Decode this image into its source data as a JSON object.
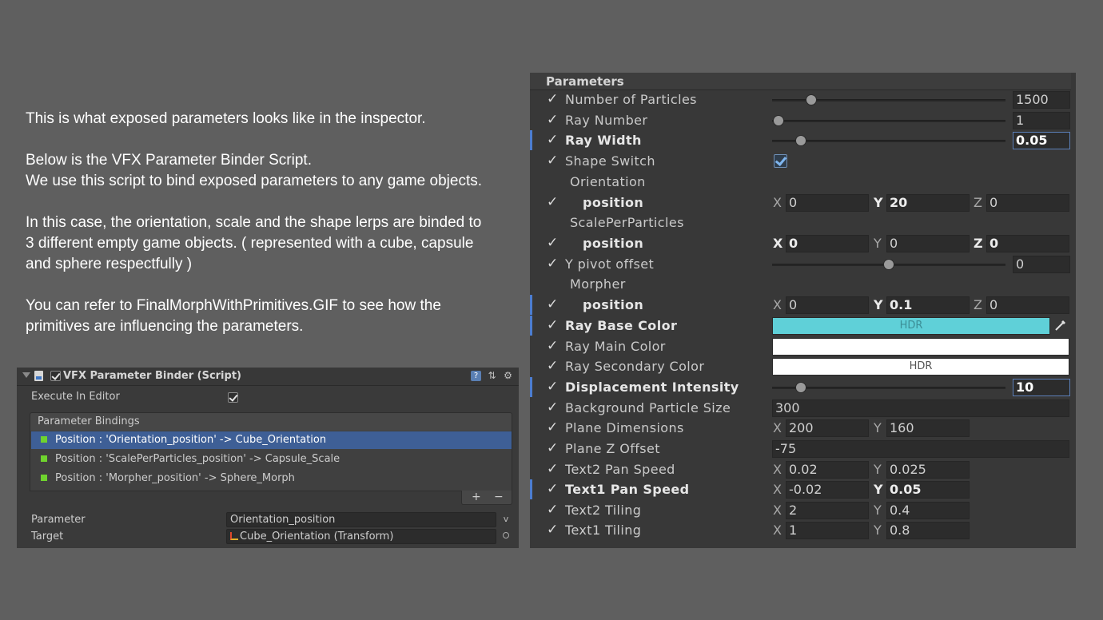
{
  "description": {
    "line1": "This is what exposed parameters looks like in the inspector.",
    "line2": "Below is the VFX Parameter Binder Script.",
    "line3": "We use this script to bind exposed parameters to any game objects.",
    "line4": "In this case, the orientation, scale and the shape lerps are binded to",
    "line5": "3 different empty game objects. ( represented with a cube, capsule",
    "line6": "and sphere respectfully )",
    "line7": "You can refer to FinalMorphWithPrimitives.GIF to see how the",
    "line8": "primitives are influencing the parameters."
  },
  "binder": {
    "title": "VFX Parameter Binder (Script)",
    "execute_label": "Execute In Editor",
    "list_header": "Parameter Bindings",
    "bindings": [
      {
        "label": "Position : 'Orientation_position' -> Cube_Orientation"
      },
      {
        "label": "Position : 'ScalePerParticles_position' -> Capsule_Scale"
      },
      {
        "label": "Position : 'Morpher_position' -> Sphere_Morph"
      }
    ],
    "plus": "+",
    "minus": "−",
    "parameter_label": "Parameter",
    "parameter_value": "Orientation_position",
    "dropdown": "v",
    "target_label": "Target",
    "target_value": "Cube_Orientation (Transform)"
  },
  "params": {
    "title": "Parameters",
    "check": "✓",
    "number_of_particles": {
      "label": "Number of Particles",
      "value": "1500",
      "slider": 0.15
    },
    "ray_number": {
      "label": "Ray Number",
      "value": "1",
      "slider": 0.0
    },
    "ray_width": {
      "label": "Ray Width",
      "value": "0.05",
      "slider": 0.1
    },
    "shape_switch": {
      "label": "Shape Switch",
      "checked": true
    },
    "orientation": {
      "label": "Orientation"
    },
    "orientation_position": {
      "label": "position",
      "x": "0",
      "y": "20",
      "z": "0"
    },
    "scale_per_particles": {
      "label": "ScalePerParticles"
    },
    "scale_position": {
      "label": "position",
      "x": "0",
      "y": "0",
      "z": "0"
    },
    "y_pivot_offset": {
      "label": "Y pivot offset",
      "value": "0",
      "slider": 0.5
    },
    "morpher": {
      "label": "Morpher"
    },
    "morpher_position": {
      "label": "position",
      "x": "0",
      "y": "0.1",
      "z": "0"
    },
    "ray_base_color": {
      "label": "Ray Base Color",
      "hdr": "HDR",
      "color": "#5fd0d8"
    },
    "ray_main_color": {
      "label": "Ray Main Color",
      "color": "#ffffff"
    },
    "ray_secondary_color": {
      "label": "Ray Secondary Color",
      "hdr": "HDR",
      "color": "#ffffff"
    },
    "displacement_intensity": {
      "label": "Displacement Intensity",
      "value": "10",
      "slider": 0.1
    },
    "background_particle_size": {
      "label": "Background Particle Size",
      "value": "300"
    },
    "plane_dimensions": {
      "label": "Plane Dimensions",
      "x": "200",
      "y": "160"
    },
    "plane_z_offset": {
      "label": "Plane Z Offset",
      "value": "-75"
    },
    "text2_pan_speed": {
      "label": "Text2 Pan Speed",
      "x": "0.02",
      "y": "0.025"
    },
    "text1_pan_speed": {
      "label": "Text1 Pan Speed",
      "x": "-0.02",
      "y": "0.05"
    },
    "text2_tiling": {
      "label": "Text2 Tiling",
      "x": "2",
      "y": "0.4"
    },
    "text1_tiling": {
      "label": "Text1 Tiling",
      "x": "1",
      "y": "0.8"
    },
    "axis_x": "X",
    "axis_y": "Y",
    "axis_z": "Z"
  }
}
